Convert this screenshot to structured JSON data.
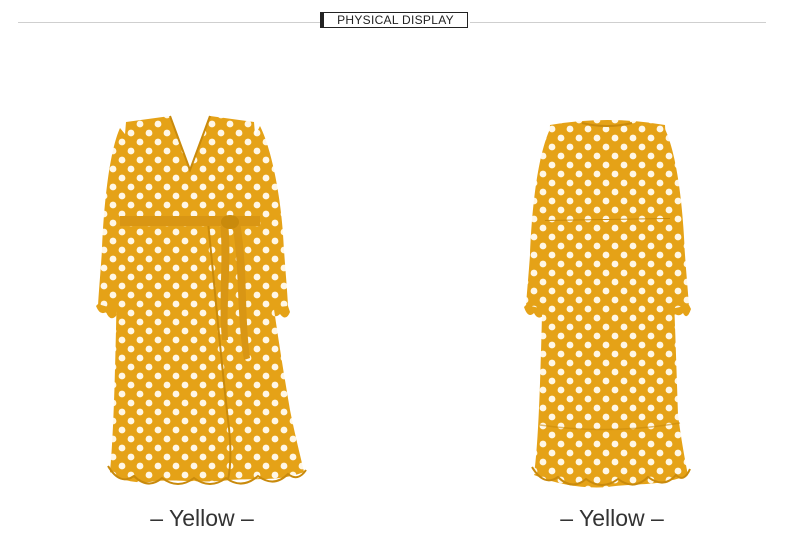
{
  "header": {
    "title": "PHYSICAL DISPLAY"
  },
  "products": [
    {
      "caption": "– Yellow –",
      "color": "#E5A217",
      "view": "front"
    },
    {
      "caption": "– Yellow –",
      "color": "#E5A217",
      "view": "back"
    }
  ],
  "colors": {
    "dress": "#E5A217",
    "dress_shadow": "#C98A0C",
    "dots": "#FFF7E6",
    "header_line": "#CFCFCF"
  }
}
